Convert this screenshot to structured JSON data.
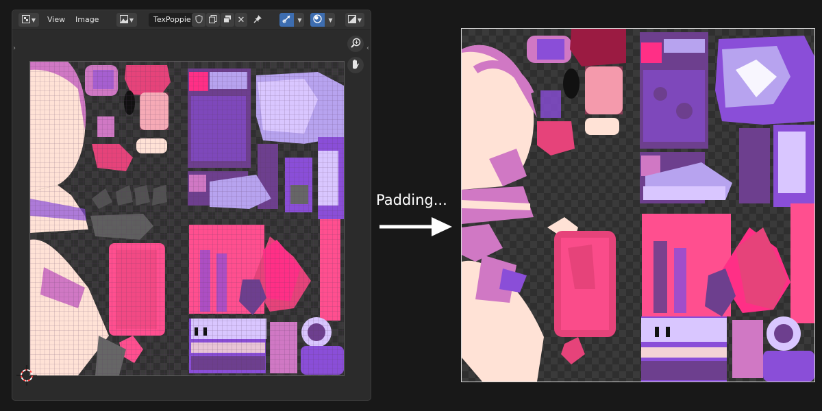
{
  "editor": {
    "menus": {
      "view": "View",
      "image": "Image"
    },
    "image_name": "TexPoppie",
    "icons": {
      "editor_type": "uv-editor-icon",
      "image_type": "image-icon",
      "fake_user": "shield-icon",
      "new_image": "new-image-icon",
      "open_image": "open-image-icon",
      "unlink": "close-icon",
      "pin": "pin-icon",
      "sync": "uv-sync-icon",
      "overlay": "overlay-icon",
      "display": "display-channels-icon",
      "zoom": "zoom-icon",
      "pan": "hand-icon"
    }
  },
  "annotation": {
    "caption": "Padding..."
  },
  "colors": {
    "pink_light": "#d078c4",
    "skin": "#ffe2d6",
    "magenta": "#e6437a",
    "lavender": "#b7a3ef",
    "purple": "#8a4ed8",
    "violet": "#6d3f8e",
    "hot_pink": "#ff2f86",
    "dark": "#111111"
  }
}
